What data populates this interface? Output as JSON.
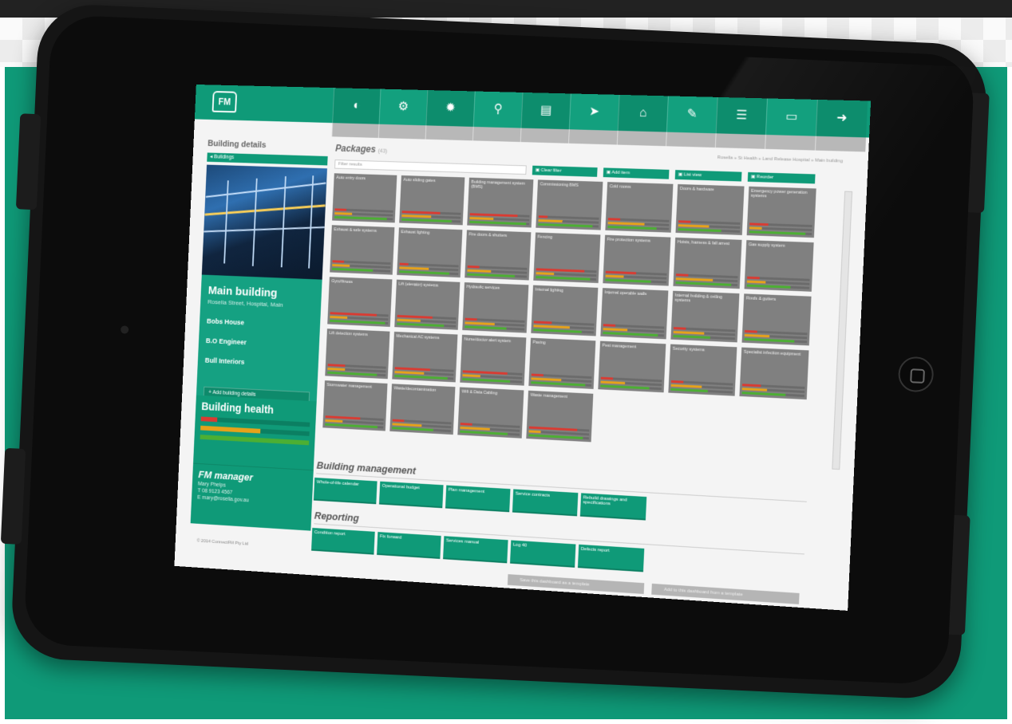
{
  "colors": {
    "accent": "#0f9a78",
    "tile": "#808080",
    "red": "#d93b32",
    "amber": "#e6a21a",
    "green": "#4caf33"
  },
  "nav": {
    "logo": "FM",
    "icons": [
      "globe-icon",
      "share-icon",
      "gear-icon",
      "pin-icon",
      "document-icon",
      "plane-icon",
      "building-icon",
      "wrench-icon",
      "list-icon",
      "calendar-icon",
      "logout-icon"
    ],
    "glyphs": [
      "◐",
      "⚙",
      "✹",
      "⚲",
      "▤",
      "➤",
      "⌂",
      "✎",
      "☰",
      "▭",
      "➜"
    ]
  },
  "sidebar": {
    "title": "Building details",
    "back_label": "◂ Buildings",
    "building_name": "Main building",
    "building_address": "Rosella Street, Hospital, Main",
    "contacts": [
      "Bobs House",
      "B.O Engineer",
      "Bull Interiors"
    ],
    "add_label": "+ Add building details",
    "health_title": "Building health",
    "health_levels": [
      0.15,
      0.55,
      1.0
    ],
    "manager_title": "FM manager",
    "manager_lines": [
      "Mary Phelps",
      "T  08 9123 4567",
      "E  mary@rosella.gov.au"
    ],
    "copyright": "© 2014 ConnectFM Pty Ltd"
  },
  "main": {
    "title": "Packages",
    "title_sub": "(43)",
    "breadcrumb": "Rosella » St Health » Land Release Hospital » Main building",
    "search_placeholder": "Filter results",
    "filter_buttons": [
      "▣ Clear filter",
      "▣ Add item",
      "▣ List view",
      "▣ Reorder"
    ],
    "tiles": [
      {
        "name": "Auto entry doors",
        "levels": [
          0.2,
          0.3,
          0.9
        ]
      },
      {
        "name": "Auto sliding gates",
        "levels": [
          0.65,
          0.5,
          0.85
        ]
      },
      {
        "name": "Building management system (BMS)",
        "levels": [
          0.8,
          0.4,
          0.95
        ]
      },
      {
        "name": "Commissioning BMS",
        "levels": [
          0.15,
          0.4,
          0.9
        ]
      },
      {
        "name": "Cold rooms",
        "levels": [
          0.2,
          0.6,
          0.8
        ]
      },
      {
        "name": "Doors & hardware",
        "levels": [
          0.2,
          0.5,
          0.7
        ]
      },
      {
        "name": "Emergency power generation systems",
        "levels": [
          0.3,
          0.2,
          0.9
        ]
      },
      {
        "name": "Exhaust & safe systems",
        "levels": [
          0.2,
          0.3,
          0.7
        ]
      },
      {
        "name": "Exhaust lighting",
        "levels": [
          0.15,
          0.5,
          0.85
        ]
      },
      {
        "name": "Fire doors & shutters",
        "levels": [
          0.2,
          0.4,
          0.8
        ]
      },
      {
        "name": "Fencing",
        "levels": [
          0.8,
          0.3,
          0.9
        ]
      },
      {
        "name": "Fire protection systems",
        "levels": [
          0.5,
          0.3,
          0.75
        ]
      },
      {
        "name": "Hoists, harness & fall arrest",
        "levels": [
          0.2,
          0.6,
          0.9
        ]
      },
      {
        "name": "Gas supply system",
        "levels": [
          0.2,
          0.3,
          0.7
        ]
      },
      {
        "name": "Gym/fitness",
        "levels": [
          0.8,
          0.3,
          0.95
        ]
      },
      {
        "name": "Lift (elevator) systems",
        "levels": [
          0.6,
          0.4,
          0.8
        ]
      },
      {
        "name": "Hydraulic services",
        "levels": [
          0.2,
          0.5,
          0.7
        ]
      },
      {
        "name": "Internal lighting",
        "levels": [
          0.3,
          0.6,
          0.8
        ]
      },
      {
        "name": "Internal operable walls",
        "levels": [
          0.2,
          0.4,
          0.9
        ]
      },
      {
        "name": "Internal building & ceiling systems",
        "levels": [
          0.2,
          0.5,
          0.6
        ]
      },
      {
        "name": "Roofs & gutters",
        "levels": [
          0.2,
          0.4,
          0.8
        ]
      },
      {
        "name": "Lift detection systems",
        "levels": [
          0.3,
          0.3,
          0.85
        ]
      },
      {
        "name": "Mechanical AC systems",
        "levels": [
          0.6,
          0.5,
          0.9
        ]
      },
      {
        "name": "Nurse/doctor alert system",
        "levels": [
          0.75,
          0.3,
          0.8
        ]
      },
      {
        "name": "Paving",
        "levels": [
          0.2,
          0.5,
          0.9
        ]
      },
      {
        "name": "Pest management",
        "levels": [
          0.2,
          0.4,
          0.8
        ]
      },
      {
        "name": "Security systems",
        "levels": [
          0.2,
          0.5,
          0.6
        ]
      },
      {
        "name": "Specialist infection equipment",
        "levels": [
          0.3,
          0.4,
          0.7
        ]
      },
      {
        "name": "Stormwater management",
        "levels": [
          0.6,
          0.3,
          0.9
        ]
      },
      {
        "name": "Waste/decontamination",
        "levels": [
          0.2,
          0.5,
          0.7
        ]
      },
      {
        "name": "Wifi & Data Cabling",
        "levels": [
          0.2,
          0.5,
          0.8
        ]
      },
      {
        "name": "Waste management",
        "levels": [
          0.8,
          0.2,
          0.9
        ]
      }
    ]
  },
  "building_management": {
    "title": "Building management",
    "buttons": [
      "Whole-of-life calendar",
      "Operational budget",
      "Plan management",
      "Service contracts",
      "Rebuild drawings and specifications"
    ]
  },
  "reporting": {
    "title": "Reporting",
    "buttons": [
      "Condition report",
      "Fix forward",
      "Services manual",
      "Log 40",
      "Defects report"
    ]
  },
  "footer_buttons": [
    "Save this dashboard as a template",
    "Add to this dashboard from a template"
  ]
}
